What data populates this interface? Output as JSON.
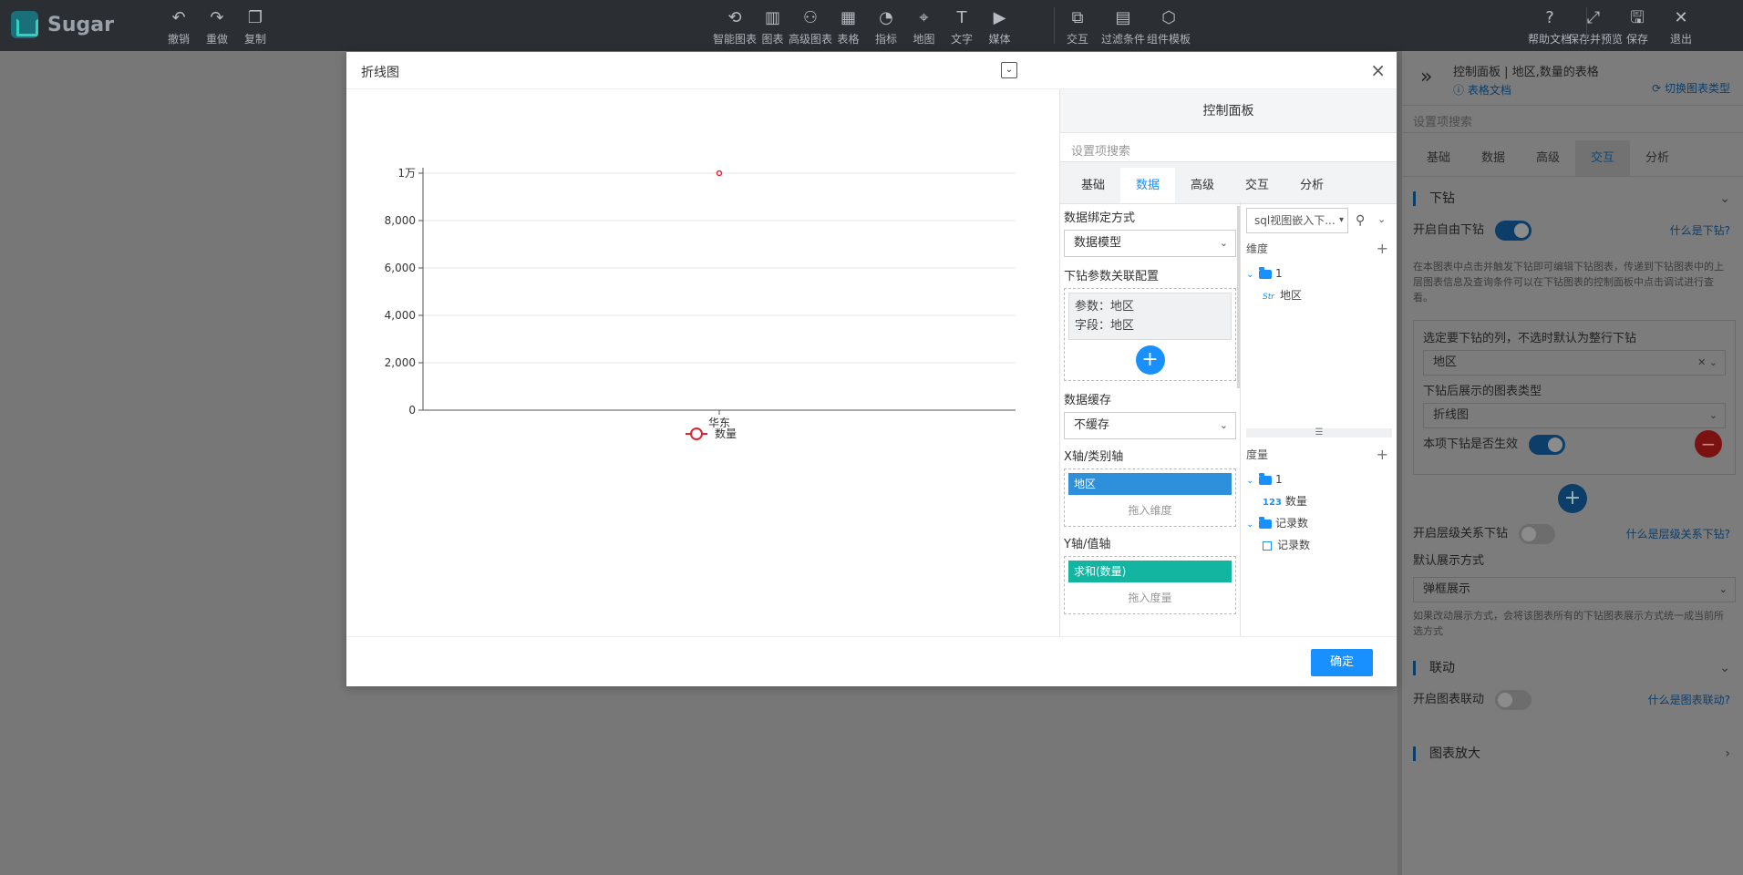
{
  "app": {
    "name": "Sugar"
  },
  "toolbar": {
    "left": [
      {
        "label": "撤销",
        "icon": "undo-icon",
        "glyph": "↶"
      },
      {
        "label": "重做",
        "icon": "redo-icon",
        "glyph": "↷"
      },
      {
        "label": "复制",
        "icon": "copy-icon",
        "glyph": "❐"
      }
    ],
    "center": [
      {
        "label": "智能图表",
        "icon": "smart-chart-icon",
        "glyph": "⟲"
      },
      {
        "label": "图表",
        "icon": "chart-icon",
        "glyph": "▥"
      },
      {
        "label": "高级图表",
        "icon": "advanced-chart-icon",
        "glyph": "⚇"
      },
      {
        "label": "表格",
        "icon": "table-icon",
        "glyph": "▦"
      },
      {
        "label": "指标",
        "icon": "gauge-icon",
        "glyph": "◔"
      },
      {
        "label": "地图",
        "icon": "map-pin-icon",
        "glyph": "⌖"
      },
      {
        "label": "文字",
        "icon": "text-icon",
        "glyph": "T"
      },
      {
        "label": "媒体",
        "icon": "media-icon",
        "glyph": "▶"
      }
    ],
    "center2": [
      {
        "label": "交互",
        "icon": "interaction-icon",
        "glyph": "⧉"
      },
      {
        "label": "过滤条件",
        "icon": "filter-icon",
        "glyph": "▤"
      },
      {
        "label": "组件模板",
        "icon": "template-icon",
        "glyph": "⬡"
      }
    ],
    "right": [
      {
        "label": "帮助文档",
        "icon": "help-icon",
        "glyph": "?"
      },
      {
        "label": "保存并预览",
        "icon": "expand-icon",
        "glyph": "⤢"
      },
      {
        "label": "保存",
        "icon": "save-icon",
        "glyph": "🖫"
      },
      {
        "label": "退出",
        "icon": "exit-icon",
        "glyph": "✕"
      }
    ]
  },
  "side_panel": {
    "title": "控制面板 | 地区,数量的表格",
    "doc_link": "表格文档",
    "switch_type": "切换图表类型",
    "search_placeholder": "设置项搜索",
    "tabs": [
      "基础",
      "数据",
      "高级",
      "交互",
      "分析"
    ],
    "active_tab": "交互",
    "drill": {
      "section": "下钻",
      "free_drill_label": "开启自由下钻",
      "free_drill_on": true,
      "what_is_drill": "什么是下钻?",
      "note": "在本图表中点击并触发下钻即可编辑下钻图表，传递到下钻图表中的上层图表信息及查询条件可以在下钻图表的控制面板中点击调试进行查看。",
      "select_col_label": "选定要下钻的列，不选时默认为整行下钻",
      "select_col_value": "地区",
      "chart_type_label": "下钻后展示的图表类型",
      "chart_type_value": "折线图",
      "effective_label": "本项下钻是否生效",
      "effective_on": true,
      "hierarchy_label": "开启层级关系下钻",
      "hierarchy_on": false,
      "what_is_hierarchy": "什么是层级关系下钻?",
      "display_label": "默认展示方式",
      "display_value": "弹框展示",
      "display_note": "如果改动展示方式，会将该图表所有的下钻图表展示方式统一成当前所选方式"
    },
    "linkage": {
      "section": "联动",
      "toggle_label": "开启图表联动",
      "toggle_on": false,
      "what_is": "什么是图表联动?"
    },
    "zoom": {
      "section": "图表放大"
    }
  },
  "modal": {
    "title": "折线图",
    "confirm": "确定",
    "control": {
      "title": "控制面板",
      "search_placeholder": "设置项搜索",
      "tabs": [
        "基础",
        "数据",
        "高级",
        "交互",
        "分析"
      ],
      "active_tab": "数据",
      "bind_label": "数据绑定方式",
      "bind_value": "数据模型",
      "drill_param_label": "下钻参数关联配置",
      "param_line": "参数：地区",
      "field_line": "字段：地区",
      "cache_label": "数据缓存",
      "cache_value": "不缓存",
      "x_axis_label": "X轴/类别轴",
      "x_axis_field": "地区",
      "x_drop_hint": "拖入维度",
      "y_axis_label": "Y轴/值轴",
      "y_axis_field": "求和(数量)",
      "y_drop_hint": "拖入度量",
      "datasource": "sql视图嵌入下...",
      "dimension_label": "维度",
      "dim_folder": "1",
      "dim_type": "Str",
      "dim_field": "地区",
      "measure_label": "度量",
      "mea_folder": "1",
      "mea_type": "123",
      "mea_field": "数量",
      "rec_folder": "记录数",
      "rec_field": "记录数"
    }
  },
  "chart_data": {
    "type": "line",
    "categories": [
      "华东"
    ],
    "series": [
      {
        "name": "数量",
        "values": [
          10000
        ],
        "color": "#e0242f"
      }
    ],
    "y_ticks": [
      "0",
      "2,000",
      "4,000",
      "6,000",
      "8,000",
      "1万"
    ],
    "ylim": [
      0,
      10000
    ],
    "grid": true,
    "legend": "bottom-center"
  }
}
